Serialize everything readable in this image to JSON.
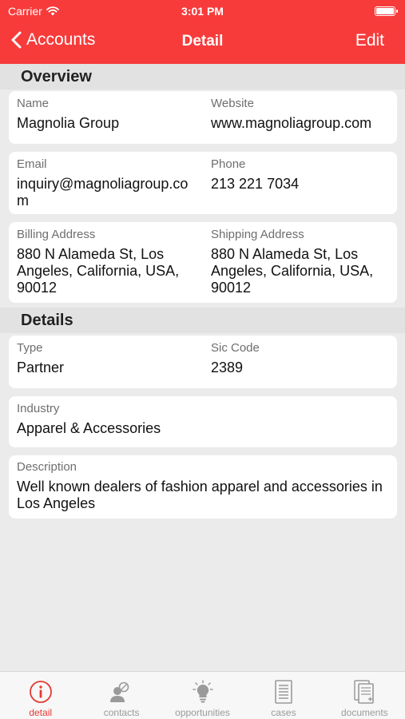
{
  "status_bar": {
    "carrier": "Carrier",
    "time": "3:01 PM",
    "battery_level": 1.0
  },
  "nav": {
    "back_label": "Accounts",
    "title": "Detail",
    "edit_label": "Edit"
  },
  "sections": {
    "overview": "Overview",
    "details": "Details"
  },
  "overview": {
    "name": {
      "label": "Name",
      "value": "Magnolia Group"
    },
    "website": {
      "label": "Website",
      "value": "www.magnoliagroup.com"
    },
    "email": {
      "label": "Email",
      "value": "inquiry@magnoliagroup.com"
    },
    "phone": {
      "label": "Phone",
      "value": "213 221 7034"
    },
    "billing_address": {
      "label": "Billing Address",
      "value": "880 N Alameda St, Los Angeles, California, USA, 90012"
    },
    "shipping_address": {
      "label": "Shipping Address",
      "value": "880 N Alameda St, Los Angeles, California, USA, 90012"
    }
  },
  "details": {
    "type": {
      "label": "Type",
      "value": "Partner"
    },
    "sic_code": {
      "label": "Sic Code",
      "value": "2389"
    },
    "industry": {
      "label": "Industry",
      "value": "Apparel & Accessories"
    },
    "description": {
      "label": "Description",
      "value": "Well known dealers of fashion apparel and accessories in Los Angeles"
    }
  },
  "tabs": [
    {
      "label": "detail",
      "icon": "info-icon",
      "active": true
    },
    {
      "label": "contacts",
      "icon": "contacts-icon",
      "active": false
    },
    {
      "label": "opportunities",
      "icon": "lightbulb-icon",
      "active": false
    },
    {
      "label": "cases",
      "icon": "cases-icon",
      "active": false
    },
    {
      "label": "documents",
      "icon": "documents-icon",
      "active": false
    }
  ],
  "colors": {
    "brand_red": "#f73b3b",
    "active_tab": "#e53935",
    "inactive_tab": "#9a9a9a",
    "background": "#ebebeb"
  }
}
